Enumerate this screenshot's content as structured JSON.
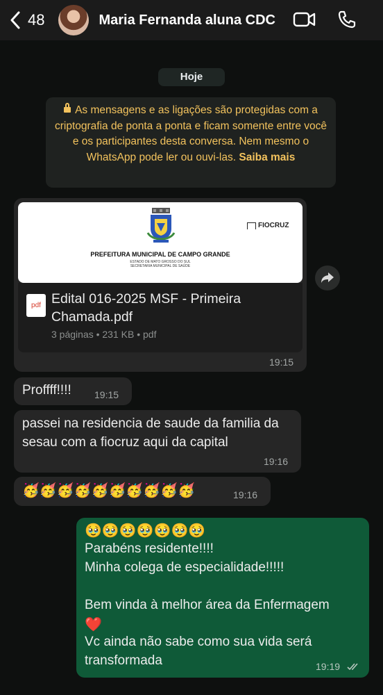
{
  "header": {
    "back_count": "48",
    "contact_name": "Maria Fernanda aluna CDC"
  },
  "chat": {
    "date_chip": "Hoje",
    "e2e_notice": {
      "text": "As mensagens e as ligações são protegidas com a criptografia de ponta a ponta e ficam somente entre você e os participantes desta conversa. Nem mesmo o WhatsApp pode ler ou ouvi-las.",
      "link": "Saiba mais"
    },
    "messages": [
      {
        "type": "document",
        "direction": "in",
        "preview": {
          "title": "PREFEITURA MUNICIPAL DE CAMPO GRANDE",
          "sub1": "ESTADO DE MATO GROSSO DO SUL",
          "sub2": "SECRETARIA MUNICIPAL DE SAÚDE",
          "logo_text": "FIOCRUZ"
        },
        "file_name": "Edital 016-2025 MSF - Primeira Chamada.pdf",
        "file_icon": "pdf",
        "meta": "3 páginas • 231 KB • pdf",
        "time": "19:15"
      },
      {
        "type": "text",
        "direction": "in",
        "text": "Proffff!!!!",
        "time": "19:15"
      },
      {
        "type": "text",
        "direction": "in",
        "text": "passei na residencia de saude da familia da sesau com a fiocruz aqui da capital",
        "time": "19:16"
      },
      {
        "type": "text",
        "direction": "in",
        "text": "🥳🥳🥳🥳🥳🥳🥳🥳🥳🥳",
        "time": "19:16"
      },
      {
        "type": "text",
        "direction": "out",
        "lines": [
          "🥹🥹🥹🥹🥹🥹🥹",
          "Parabéns residente!!!!",
          "Minha colega de especialidade!!!!!",
          "",
          "Bem vinda à melhor área da Enfermagem",
          "❤️",
          "Vc ainda não sabe como sua vida será",
          "transformada"
        ],
        "time": "19:19",
        "status": "read"
      }
    ]
  },
  "colors": {
    "header_bg": "#1b1b1b",
    "incoming_bubble": "#262626",
    "outgoing_bubble": "#0f5a38",
    "notice_text": "#f2c25d"
  }
}
